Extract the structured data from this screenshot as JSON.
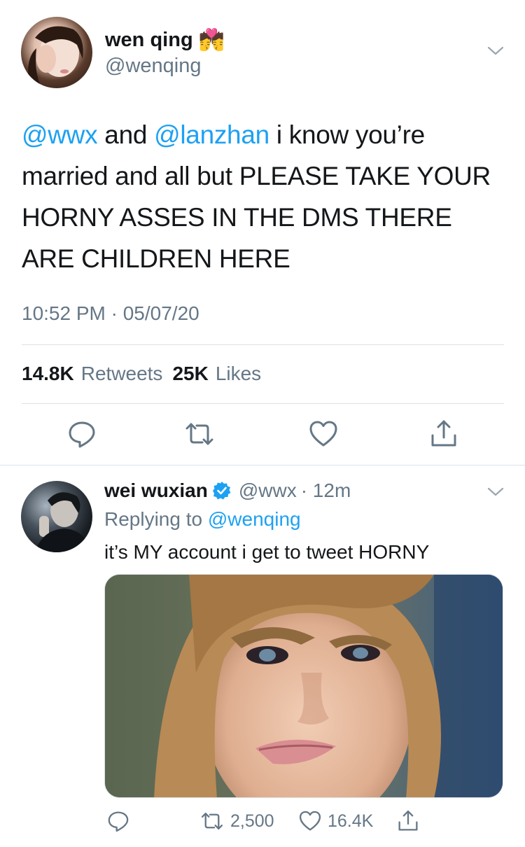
{
  "main_tweet": {
    "display_name": "wen qing",
    "name_emoji": "💏",
    "handle": "@wenqing",
    "text_parts": [
      {
        "text": "@wwx",
        "type": "mention"
      },
      {
        "text": " and ",
        "type": "text"
      },
      {
        "text": "@lanzhan",
        "type": "mention"
      },
      {
        "text": " i know you’re married and all but PLEASE TAKE YOUR HORNY ASSES IN THE DMS THERE ARE CHILDREN HERE",
        "type": "text"
      }
    ],
    "timestamp": "10:52 PM · 05/07/20",
    "retweets_count": "14.8K",
    "retweets_label": "Retweets",
    "likes_count": "25K",
    "likes_label": "Likes"
  },
  "reply_tweet": {
    "display_name": "wei wuxian",
    "handle": "@wwx",
    "time": "· 12m",
    "replying_prefix": "Replying to",
    "replying_to": "@wenqing",
    "text": "it’s MY account i get to tweet HORNY",
    "retweets": "2,500",
    "likes": "16.4K"
  },
  "colors": {
    "link": "#1da1f2",
    "secondary_text": "#657786",
    "divider": "#dde2e6",
    "verified": "#1da1f2"
  }
}
